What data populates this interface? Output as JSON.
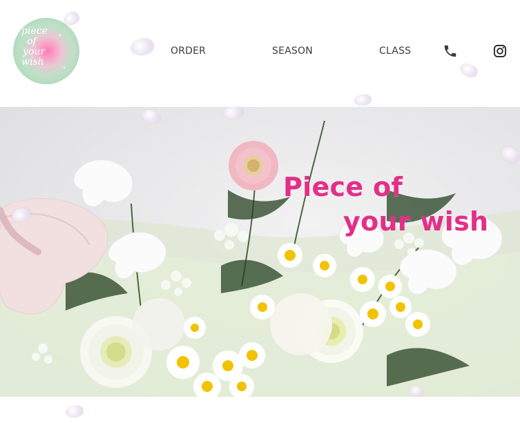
{
  "header": {
    "logo": {
      "lines": [
        "piece",
        "of",
        "your",
        "wish"
      ]
    },
    "nav": [
      {
        "label": "ORDER"
      },
      {
        "label": "SEASON"
      },
      {
        "label": "CLASS"
      }
    ],
    "icons": {
      "phone": "phone-icon",
      "instagram": "instagram-icon"
    }
  },
  "hero": {
    "title_line1": "Piece of",
    "title_line2": "your wish"
  },
  "colors": {
    "title": "#e32f88",
    "nav_text": "#3b3b3b",
    "logo_green": "#a7d6b7",
    "logo_pink": "#ff7ab8",
    "petal": "#e7dbef"
  }
}
